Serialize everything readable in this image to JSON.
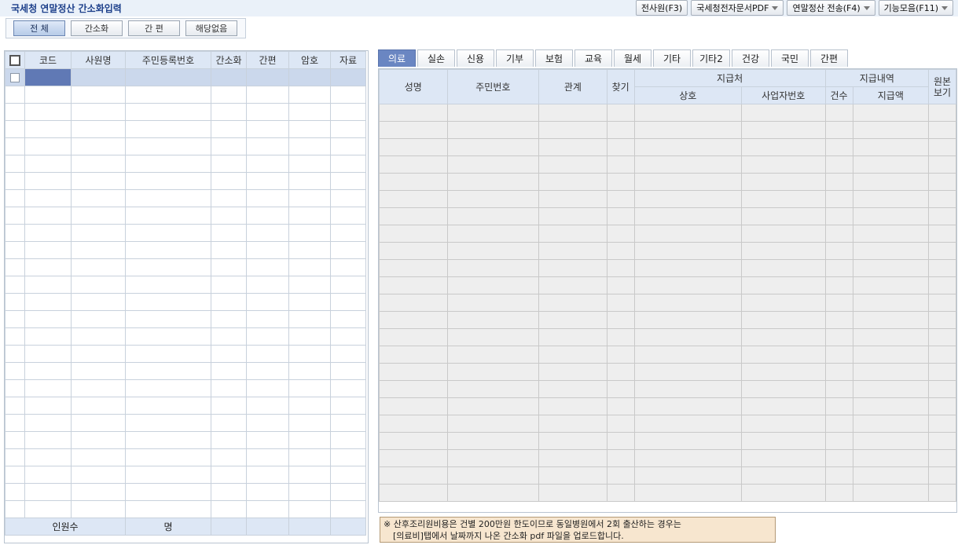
{
  "app": {
    "title": "국세청 연말정산 간소화입력"
  },
  "toolbar": [
    {
      "label": "전사원(F3)",
      "dropdown": false
    },
    {
      "label": "국세청전자문서PDF",
      "dropdown": true
    },
    {
      "label": "연말정산 전송(F4)",
      "dropdown": true
    },
    {
      "label": "기능모음(F11)",
      "dropdown": true
    }
  ],
  "filters": [
    {
      "label": "전 체",
      "active": true
    },
    {
      "label": "간소화",
      "active": false
    },
    {
      "label": "간 편",
      "active": false
    },
    {
      "label": "해당없음",
      "active": false
    }
  ],
  "employee_table": {
    "columns": [
      "코드",
      "사원명",
      "주민등록번호",
      "간소화",
      "간편",
      "암호",
      "자료"
    ],
    "empty_rows": 25,
    "footer": {
      "count_label": "인원수",
      "unit_label": "명"
    }
  },
  "tabs": [
    {
      "label": "의료",
      "active": true
    },
    {
      "label": "실손"
    },
    {
      "label": "신용"
    },
    {
      "label": "기부"
    },
    {
      "label": "보험"
    },
    {
      "label": "교육"
    },
    {
      "label": "월세"
    },
    {
      "label": "기타"
    },
    {
      "label": "기타2"
    },
    {
      "label": "건강"
    },
    {
      "label": "국민"
    },
    {
      "label": "간편"
    }
  ],
  "detail_table": {
    "headers": {
      "name": "성명",
      "resident_no": "주민번호",
      "relation": "관계",
      "find": "찾기",
      "payee": "지급처",
      "payee_name": "상호",
      "business_no": "사업자번호",
      "payment": "지급내역",
      "count": "건수",
      "amount": "지급액",
      "original_line1": "원본",
      "original_line2": "보기"
    },
    "empty_rows": 23
  },
  "note": {
    "line1": "※ 산후조리원비용은 건별 200만원 한도이므로 동일병원에서 2회 출산하는 경우는",
    "line2": "[의료비]탭에서 날짜까지 나온 간소화 pdf 파일을 업로드합니다."
  },
  "colors": {
    "accent": "#6a86c2",
    "header_bg": "#dde7f5",
    "selected_cell": "#6079b5",
    "note_bg": "#f7e6cf"
  }
}
